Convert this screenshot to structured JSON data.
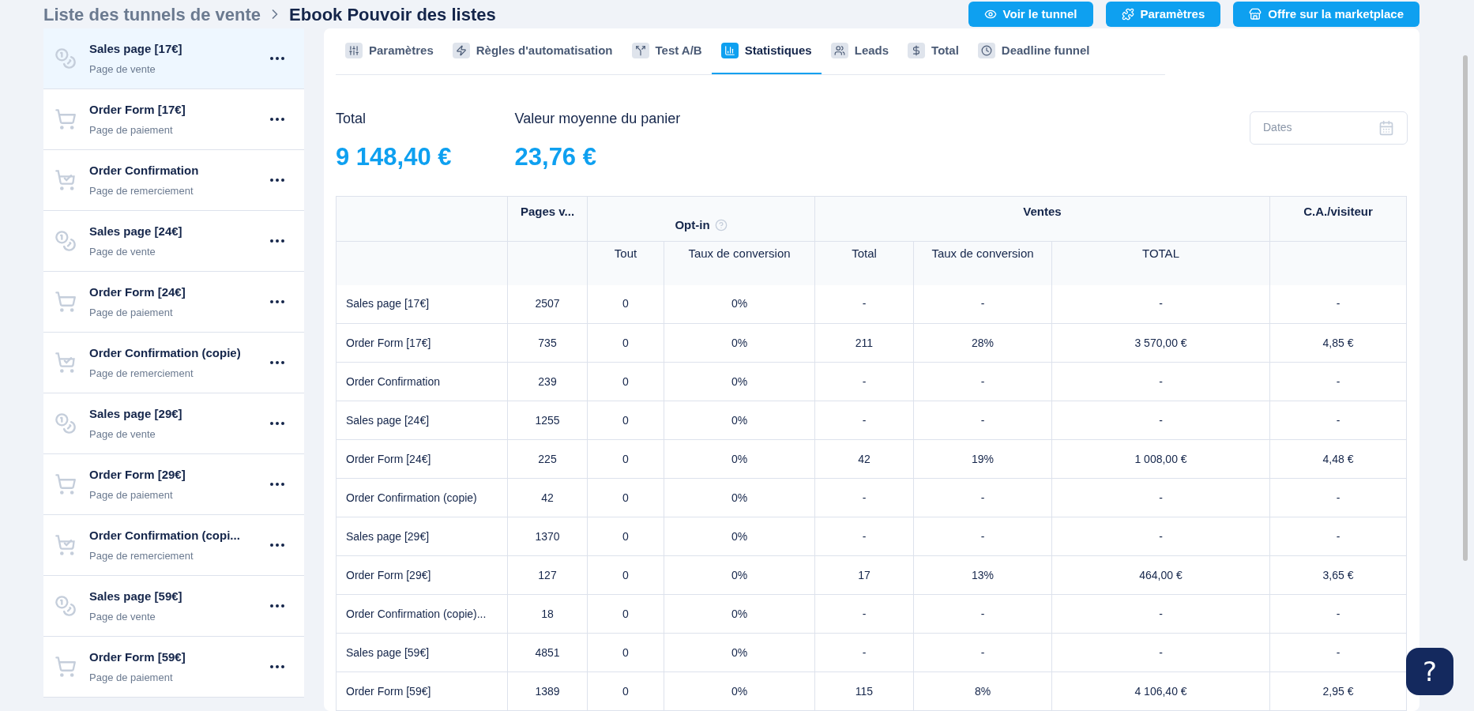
{
  "breadcrumb": [
    "Liste des tunnels de vente",
    "Ebook Pouvoir des listes"
  ],
  "header_buttons": [
    {
      "label": "Voir le tunnel"
    },
    {
      "label": "Paramètres"
    },
    {
      "label": "Offre sur la marketplace"
    }
  ],
  "sidebar": {
    "items": [
      {
        "title": "Sales page [17€]",
        "subtitle": "Page de vente",
        "kind": "sales",
        "selected": true
      },
      {
        "title": "Order Form [17€]",
        "subtitle": "Page de paiement",
        "kind": "order",
        "selected": false
      },
      {
        "title": "Order Confirmation",
        "subtitle": "Page de remerciement",
        "kind": "confirmation",
        "selected": false
      },
      {
        "title": "Sales page [24€]",
        "subtitle": "Page de vente",
        "kind": "sales",
        "selected": false
      },
      {
        "title": "Order Form [24€]",
        "subtitle": "Page de paiement",
        "kind": "order",
        "selected": false
      },
      {
        "title": "Order Confirmation (copie)",
        "subtitle": "Page de remerciement",
        "kind": "confirmation",
        "selected": false
      },
      {
        "title": "Sales page [29€]",
        "subtitle": "Page de vente",
        "kind": "sales",
        "selected": false
      },
      {
        "title": "Order Form [29€]",
        "subtitle": "Page de paiement",
        "kind": "order",
        "selected": false
      },
      {
        "title": "Order Confirmation (copi...",
        "subtitle": "Page de remerciement",
        "kind": "confirmation",
        "selected": false
      },
      {
        "title": "Sales page [59€]",
        "subtitle": "Page de vente",
        "kind": "sales",
        "selected": false
      },
      {
        "title": "Order Form [59€]",
        "subtitle": "Page de paiement",
        "kind": "order",
        "selected": false
      }
    ]
  },
  "tabs": [
    {
      "label": "Paramètres",
      "selected": false
    },
    {
      "label": "Règles d'automatisation",
      "selected": false
    },
    {
      "label": "Test A/B",
      "selected": false
    },
    {
      "label": "Statistiques",
      "selected": true
    },
    {
      "label": "Leads",
      "selected": false
    },
    {
      "label": "Total",
      "selected": false
    },
    {
      "label": "Deadline funnel",
      "selected": false
    }
  ],
  "stats": [
    {
      "label": "Total",
      "value": "9 148,40 €"
    },
    {
      "label": "Valeur moyenne du panier",
      "value": "23,76 €"
    }
  ],
  "date_field": {
    "placeholder": "Dates"
  },
  "table": {
    "group_headers": [
      {
        "label": "Pages v...",
        "help": false
      },
      {
        "label": "Opt-in",
        "help": true
      },
      {
        "label": "Ventes",
        "help": false
      },
      {
        "label": "C.A./visiteur",
        "help": false
      }
    ],
    "sub_headers": [
      "Tout",
      "Taux de conversion",
      "Total",
      "Taux de conversion",
      "TOTAL"
    ],
    "rows": [
      [
        "Sales page [17€]",
        "2507",
        "0",
        "0%",
        "-",
        "-",
        "-",
        "-"
      ],
      [
        "Order Form [17€]",
        "735",
        "0",
        "0%",
        "211",
        "28%",
        "3 570,00 €",
        "4,85 €"
      ],
      [
        "Order Confirmation",
        "239",
        "0",
        "0%",
        "-",
        "-",
        "-",
        "-"
      ],
      [
        "Sales page [24€]",
        "1255",
        "0",
        "0%",
        "-",
        "-",
        "-",
        "-"
      ],
      [
        "Order Form [24€]",
        "225",
        "0",
        "0%",
        "42",
        "19%",
        "1 008,00 €",
        "4,48 €"
      ],
      [
        "Order Confirmation (copie)",
        "42",
        "0",
        "0%",
        "-",
        "-",
        "-",
        "-"
      ],
      [
        "Sales page [29€]",
        "1370",
        "0",
        "0%",
        "-",
        "-",
        "-",
        "-"
      ],
      [
        "Order Form [29€]",
        "127",
        "0",
        "0%",
        "17",
        "13%",
        "464,00 €",
        "3,65 €"
      ],
      [
        "Order Confirmation (copie)...",
        "18",
        "0",
        "0%",
        "-",
        "-",
        "-",
        "-"
      ],
      [
        "Sales page [59€]",
        "4851",
        "0",
        "0%",
        "-",
        "-",
        "-",
        "-"
      ],
      [
        "Order Form [59€]",
        "1389",
        "0",
        "0%",
        "115",
        "8%",
        "4 106,40 €",
        "2,95 €"
      ]
    ]
  },
  "help_button": {
    "label": "?"
  }
}
